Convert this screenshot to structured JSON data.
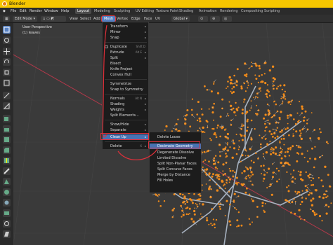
{
  "app": {
    "title": "Blender"
  },
  "menubar": {
    "items": [
      "File",
      "Edit",
      "Render",
      "Window",
      "Help"
    ],
    "workspaces": [
      "Layout",
      "Modeling",
      "Sculpting",
      "UV Editing",
      "Texture Paint",
      "Shading",
      "Animation",
      "Rendering",
      "Compositing",
      "Scripting"
    ],
    "active_workspace": "Layout"
  },
  "header": {
    "mode": "Edit Mode",
    "menus": [
      "View",
      "Select",
      "Add",
      "Mesh",
      "Vertex",
      "Edge",
      "Face",
      "UV"
    ],
    "orientation": "Global"
  },
  "viewport": {
    "view_name": "User Perspective",
    "object_name": "(1) leaves"
  },
  "mesh_menu": {
    "items": [
      {
        "label": "Transform",
        "shortcut": "",
        "submenu": true
      },
      {
        "label": "Mirror",
        "shortcut": "",
        "submenu": true
      },
      {
        "label": "Snap",
        "shortcut": "",
        "submenu": true
      },
      {
        "label": "Duplicate",
        "shortcut": "Shift D",
        "submenu": false
      },
      {
        "label": "Extrude",
        "shortcut": "Alt E",
        "submenu": true
      },
      {
        "label": "Split",
        "shortcut": "",
        "submenu": true
      },
      {
        "label": "Bisect",
        "shortcut": "",
        "submenu": false
      },
      {
        "label": "Knife Project",
        "shortcut": "",
        "submenu": false
      },
      {
        "label": "Convex Hull",
        "shortcut": "",
        "submenu": false
      },
      {
        "label": "Symmetrize",
        "shortcut": "",
        "submenu": false
      },
      {
        "label": "Snap to Symmetry",
        "shortcut": "",
        "submenu": false
      },
      {
        "label": "Normals",
        "shortcut": "Alt N",
        "submenu": true
      },
      {
        "label": "Shading",
        "shortcut": "",
        "submenu": true
      },
      {
        "label": "Weights",
        "shortcut": "",
        "submenu": true
      },
      {
        "label": "Split Elements...",
        "shortcut": "",
        "submenu": false
      },
      {
        "label": "Show/Hide",
        "shortcut": "",
        "submenu": true
      },
      {
        "label": "Separate",
        "shortcut": "",
        "submenu": true
      },
      {
        "label": "Clean Up",
        "shortcut": "",
        "submenu": true
      },
      {
        "label": "Delete",
        "shortcut": "X",
        "submenu": true
      }
    ]
  },
  "cleanup_menu": {
    "items": [
      "Delete Loose",
      "Decimate Geometry",
      "Degenerate Dissolve",
      "Limited Dissolve",
      "Split Non-Planar Faces",
      "Split Concave Faces",
      "Merge by Distance",
      "Fill Holes"
    ],
    "highlighted": "Decimate Geometry"
  },
  "icons": [
    "blender-logo-icon",
    "select-box-icon",
    "cursor-icon",
    "move-icon",
    "rotate-icon",
    "scale-icon",
    "transform-icon",
    "annotate-icon",
    "measure-icon",
    "add-cube-icon",
    "extrude-icon",
    "inset-icon",
    "bevel-icon",
    "loop-cut-icon",
    "knife-icon",
    "poly-build-icon",
    "spin-icon",
    "smooth-icon",
    "edge-slide-icon",
    "shrink-fatten-icon",
    "shear-icon",
    "rip-icon"
  ],
  "colors": {
    "title_bar": "#f6c600",
    "highlight": "#4772b3",
    "mesh_active": "#5680c2",
    "vertex_orange": "#f08a1a",
    "annotation_red": "#e0303a"
  }
}
